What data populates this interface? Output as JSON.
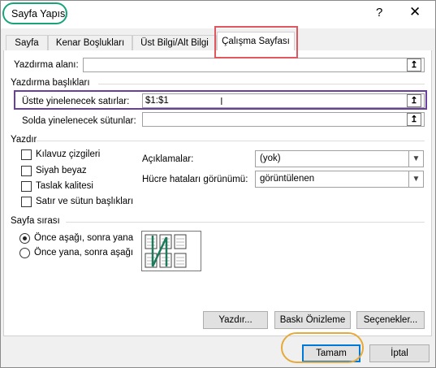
{
  "dialog": {
    "title": "Sayfa Yapısı",
    "help_glyph": "?",
    "close_glyph": "✕"
  },
  "tabs": [
    "Sayfa",
    "Kenar Boşlukları",
    "Üst Bilgi/Alt Bilgi",
    "Çalışma Sayfası"
  ],
  "print_area": {
    "label": "Yazdırma alanı:",
    "value": ""
  },
  "print_titles": {
    "heading": "Yazdırma başlıkları",
    "rows_label": "Üstte yinelenecek satırlar:",
    "rows_value": "$1:$1",
    "cols_label": "Solda yinelenecek sütunlar:",
    "cols_value": ""
  },
  "print": {
    "heading": "Yazdır",
    "checkboxes": [
      "Kılavuz çizgileri",
      "Siyah beyaz",
      "Taslak kalitesi",
      "Satır ve sütun başlıkları"
    ],
    "comments_label": "Açıklamalar:",
    "comments_value": "(yok)",
    "errors_label": "Hücre hataları görünümü:",
    "errors_value": "görüntülenen"
  },
  "page_order": {
    "heading": "Sayfa sırası",
    "options": [
      "Önce aşağı, sonra yana",
      "Önce yana, sonra aşağı"
    ],
    "selected_index": 0
  },
  "buttons": {
    "print": "Yazdır...",
    "preview": "Baskı Önizleme",
    "options": "Seçenekler...",
    "ok": "Tamam",
    "cancel": "İptal"
  },
  "pick_icon_glyph": "↥",
  "highlight_colors": {
    "title": "#1aa37a",
    "tab": "#e0585f",
    "rows": "#6b3fa0",
    "ok": "#e6a93a"
  }
}
